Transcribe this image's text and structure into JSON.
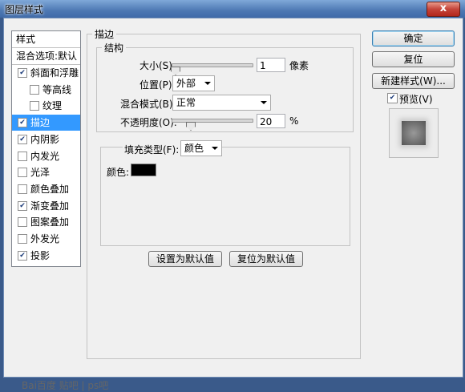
{
  "window": {
    "title": "图层样式",
    "close": "x"
  },
  "left_panel": {
    "header": "样式",
    "blend_options": "混合选项:默认",
    "items": [
      {
        "label": "斜面和浮雕",
        "checked": true,
        "indent": false,
        "selected": false
      },
      {
        "label": "等高线",
        "checked": false,
        "indent": true,
        "selected": false
      },
      {
        "label": "纹理",
        "checked": false,
        "indent": true,
        "selected": false
      },
      {
        "label": "描边",
        "checked": true,
        "indent": false,
        "selected": true
      },
      {
        "label": "内阴影",
        "checked": true,
        "indent": false,
        "selected": false
      },
      {
        "label": "内发光",
        "checked": false,
        "indent": false,
        "selected": false
      },
      {
        "label": "光泽",
        "checked": false,
        "indent": false,
        "selected": false
      },
      {
        "label": "颜色叠加",
        "checked": false,
        "indent": false,
        "selected": false
      },
      {
        "label": "渐变叠加",
        "checked": true,
        "indent": false,
        "selected": false
      },
      {
        "label": "图案叠加",
        "checked": false,
        "indent": false,
        "selected": false
      },
      {
        "label": "外发光",
        "checked": false,
        "indent": false,
        "selected": false
      },
      {
        "label": "投影",
        "checked": true,
        "indent": false,
        "selected": false
      }
    ]
  },
  "stroke": {
    "group_title": "描边",
    "structure_title": "结构",
    "size_label": "大小(S):",
    "size_value": "1",
    "size_unit": "像素",
    "position_label": "位置(P):",
    "position_value": "外部",
    "blend_label": "混合模式(B):",
    "blend_value": "正常",
    "opacity_label": "不透明度(O):",
    "opacity_value": "20",
    "opacity_unit": "%",
    "fill_type_label": "填充类型(F):",
    "fill_type_value": "颜色",
    "color_label": "颜色:",
    "color_hex": "#000000",
    "set_default": "设置为默认值",
    "reset_default": "复位为默认值"
  },
  "right": {
    "ok": "确定",
    "reset": "复位",
    "new_style": "新建样式(W)...",
    "preview_label": "预览(V)",
    "preview_checked": true
  },
  "watermark": "Bai百度 贴吧 | ps吧"
}
